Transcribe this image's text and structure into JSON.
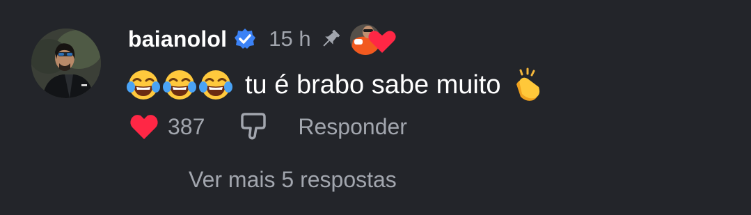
{
  "comment": {
    "username": "baianolol",
    "time": "15 h",
    "text": "tu é brabo sabe muito",
    "likes": "387",
    "reply_label": "Responder",
    "more_replies_label": "Ver mais 5 respostas",
    "icons": {
      "avatar": "user-avatar",
      "verified": "verified-badge-icon",
      "pinned": "pin-icon",
      "creator_liked": "creator-heart-avatar",
      "emoji": "laughing-tears-emoji",
      "clap": "clapping-hands-emoji",
      "like": "heart-icon",
      "dislike": "dislike-icon"
    },
    "colors": {
      "background": "#23252a",
      "verified": "#3b82f6",
      "heart": "#ff2745",
      "muted_text": "#a2a6ae"
    }
  }
}
